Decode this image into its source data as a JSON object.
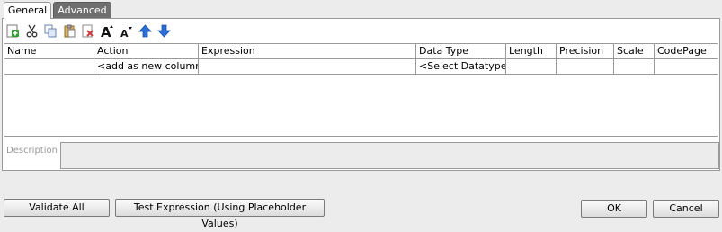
{
  "tabs": [
    {
      "label": "General",
      "active": true
    },
    {
      "label": "Advanced",
      "active": false
    }
  ],
  "toolbar": {
    "icons": [
      "add-row-icon",
      "cut-icon",
      "copy-icon",
      "paste-icon",
      "delete-icon",
      "increase-font-icon",
      "decrease-font-icon",
      "move-up-icon",
      "move-down-icon"
    ]
  },
  "grid": {
    "columns": [
      "Name",
      "Action",
      "Expression",
      "Data Type",
      "Length",
      "Precision",
      "Scale",
      "CodePage"
    ],
    "rows": [
      [
        "",
        "<add as new column>",
        "",
        "<Select Datatype>",
        "",
        "",
        "",
        ""
      ]
    ]
  },
  "description": {
    "label": "Description",
    "value": ""
  },
  "buttons": {
    "validate_all": "Validate All",
    "test_expression": "Test Expression (Using Placeholder Values)",
    "ok": "OK",
    "cancel": "Cancel"
  },
  "colors": {
    "active_tab_bg": "#ffffff",
    "inactive_tab_bg": "#6f6f6f",
    "add_icon": "#2e9e2e",
    "arrow_icon": "#2b6fd6",
    "delete_icon": "#d03a3a"
  }
}
